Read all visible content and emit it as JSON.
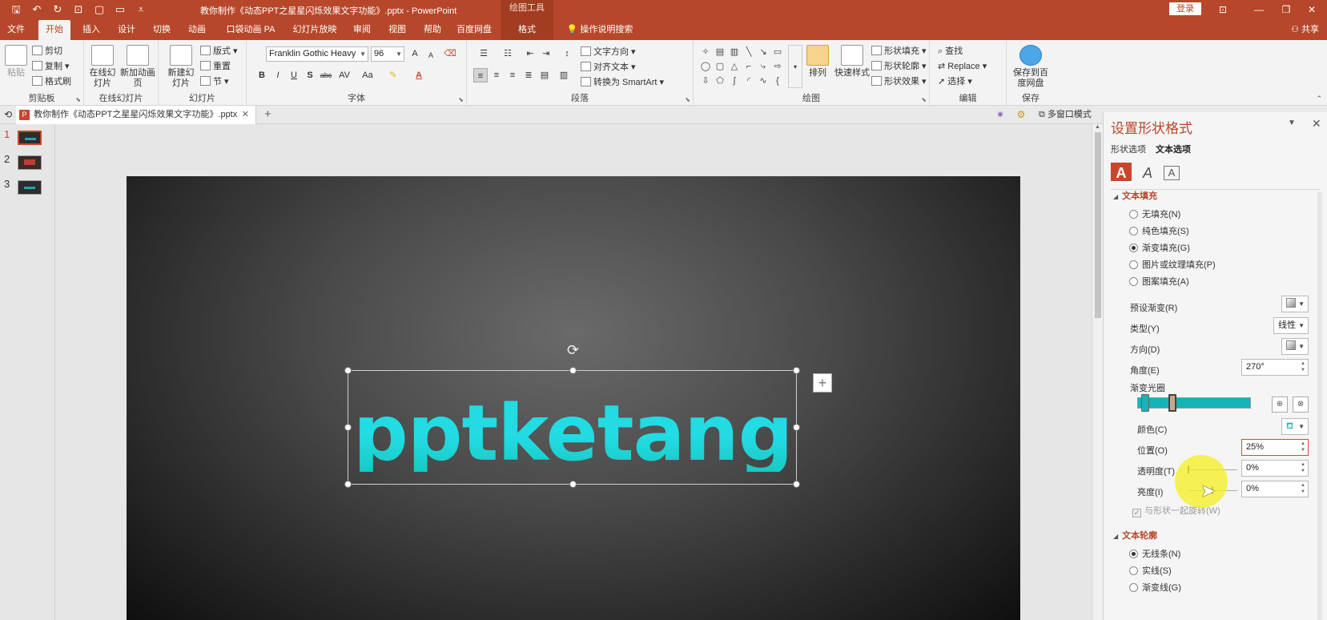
{
  "window": {
    "doc_title": "教你制作《动态PPT之星星闪烁效果文字功能》.pptx  -  PowerPoint",
    "context_tools": "绘图工具",
    "login": "登录"
  },
  "tabs": {
    "file": "文件",
    "home": "开始",
    "insert": "插入",
    "design": "设计",
    "transitions": "切换",
    "animations": "动画",
    "pocket_animation": "口袋动画 PA",
    "slideshow": "幻灯片放映",
    "review": "审阅",
    "view": "视图",
    "help": "帮助",
    "baidu": "百度网盘",
    "format": "格式",
    "tell_me": "操作说明搜索",
    "share": "共享"
  },
  "ribbon": {
    "clipboard": {
      "paste": "粘贴",
      "cut": "剪切",
      "copy": "复制",
      "painter": "格式刷",
      "label": "剪贴板"
    },
    "online_slides": {
      "online": "在线幻灯片",
      "new_anim": "新加动画页",
      "label": "在线幻灯片"
    },
    "slides": {
      "new_slide": "新建幻灯片",
      "layout": "版式",
      "reset": "重置",
      "section": "节",
      "label": "幻灯片"
    },
    "font": {
      "name": "Franklin Gothic Heavy",
      "size": "96",
      "grow": "A",
      "shrink": "A",
      "bold": "B",
      "italic": "I",
      "underline": "U",
      "shadow": "S",
      "strike": "abc",
      "spacing": "AV",
      "case": "Aa",
      "label": "字体"
    },
    "paragraph": {
      "text_dir": "文字方向",
      "align_text": "对齐文本",
      "smartart": "转换为 SmartArt",
      "label": "段落"
    },
    "drawing": {
      "arrange": "排列",
      "quick_styles": "快速样式",
      "fill": "形状填充",
      "outline": "形状轮廓",
      "effects": "形状效果",
      "label": "绘图"
    },
    "editing": {
      "find": "查找",
      "replace": "Replace",
      "select": "选择",
      "label": "编辑"
    },
    "save": {
      "save_baidu": "保存到百度网盘",
      "label": "保存"
    }
  },
  "docstrip": {
    "doc_tab": "教你制作《动态PPT之星星闪烁效果文字功能》.pptx",
    "close": "✕",
    "new_tab": "+",
    "multi_window": "多窗口模式"
  },
  "thumbnails": [
    {
      "num": "1",
      "active": true
    },
    {
      "num": "2",
      "active": false
    },
    {
      "num": "3",
      "active": false
    }
  ],
  "slide": {
    "text": "pptketang"
  },
  "pane": {
    "title": "设置形状格式",
    "subtab_shape": "形状选项",
    "subtab_text": "文本选项",
    "text_fill_title": "文本填充",
    "fill_options": [
      "无填充(N)",
      "纯色填充(S)",
      "渐变填充(G)",
      "图片或纹理填充(P)",
      "图案填充(A)"
    ],
    "fill_selected": 2,
    "preset_label": "预设渐变(R)",
    "type_label": "类型(Y)",
    "type_value": "线性",
    "direction_label": "方向(D)",
    "angle_label": "角度(E)",
    "angle_value": "270°",
    "stops_label": "渐变光圈",
    "color_label": "颜色(C)",
    "position_label": "位置(O)",
    "position_value": "25%",
    "transparency_label": "透明度(T)",
    "transparency_value": "0%",
    "brightness_label": "亮度(I)",
    "brightness_value": "0%",
    "rotate_with_shape": "与形状一起旋转(W)",
    "text_outline_title": "文本轮廓",
    "outline_options": [
      "无线条(N)",
      "实线(S)",
      "渐变线(G)"
    ],
    "outline_selected": 0
  },
  "colors": {
    "accent": "#b7472a",
    "gradient_stop": "#16b3b7",
    "text_gradient": "#22dbe3",
    "cursor_halo": "#f5f028"
  }
}
